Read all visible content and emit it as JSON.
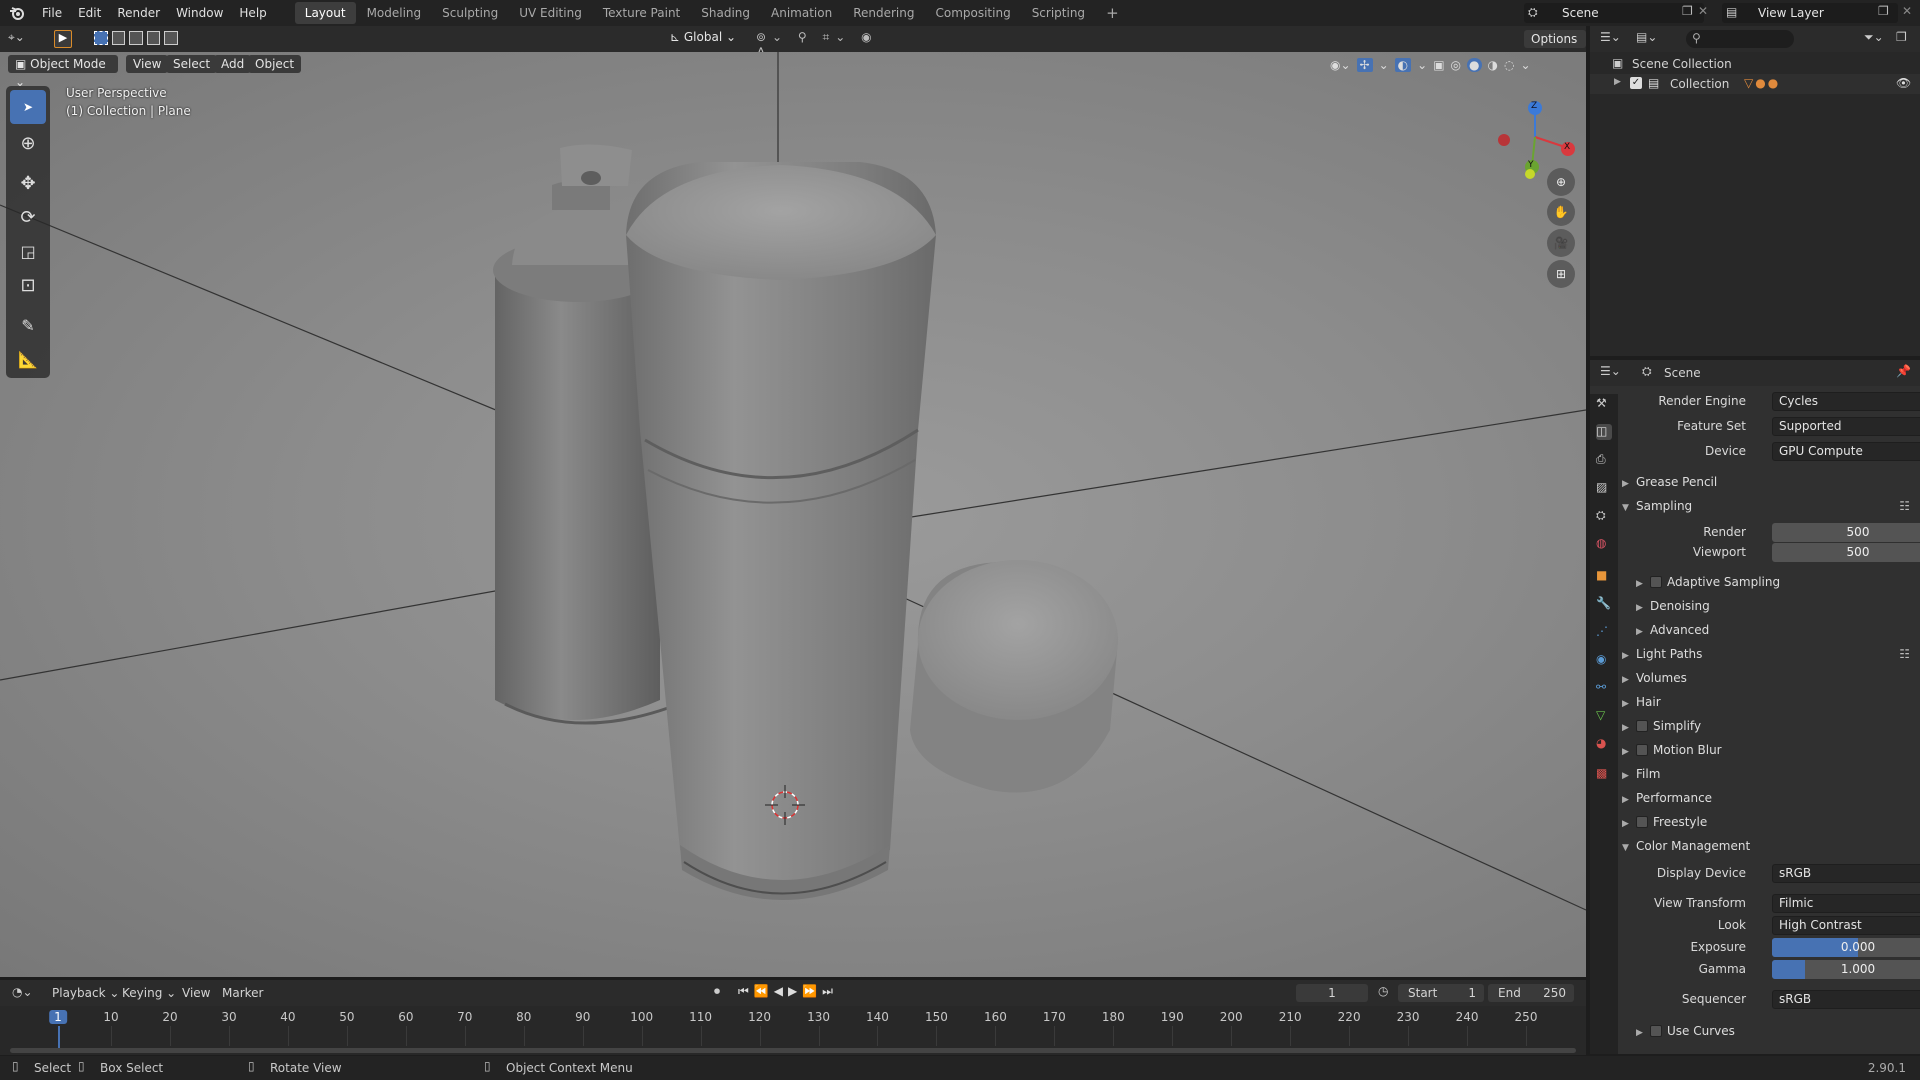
{
  "topbar": {
    "menus": [
      "File",
      "Edit",
      "Render",
      "Window",
      "Help"
    ],
    "workspaces": [
      "Layout",
      "Modeling",
      "Sculpting",
      "UV Editing",
      "Texture Paint",
      "Shading",
      "Animation",
      "Rendering",
      "Compositing",
      "Scripting"
    ],
    "active_workspace": "Layout",
    "add_tab": "+",
    "scene_name": "Scene",
    "view_layer": "View Layer"
  },
  "viewport_header": {
    "mode": "Object Mode",
    "menus": [
      "View",
      "Select",
      "Add",
      "Object"
    ],
    "orientation": "Global",
    "options": "Options"
  },
  "viewport": {
    "view_name": "User Perspective",
    "collection_info": "(1) Collection | Plane",
    "gizmo_axes": {
      "x": "X",
      "y": "Y",
      "z": "Z"
    }
  },
  "outliner": {
    "search_placeholder": "",
    "scene_collection": "Scene Collection",
    "collection": "Collection"
  },
  "properties": {
    "context": "Scene",
    "render_engine_label": "Render Engine",
    "render_engine": "Cycles",
    "feature_set_label": "Feature Set",
    "feature_set": "Supported",
    "device_label": "Device",
    "device": "GPU Compute",
    "panels": {
      "grease_pencil": "Grease Pencil",
      "sampling": "Sampling",
      "render_label": "Render",
      "render_samples": "500",
      "viewport_label": "Viewport",
      "viewport_samples": "500",
      "adaptive_sampling": "Adaptive Sampling",
      "denoising": "Denoising",
      "advanced": "Advanced",
      "light_paths": "Light Paths",
      "volumes": "Volumes",
      "hair": "Hair",
      "simplify": "Simplify",
      "motion_blur": "Motion Blur",
      "film": "Film",
      "performance": "Performance",
      "freestyle": "Freestyle",
      "color_management": "Color Management"
    },
    "color_management": {
      "display_device_label": "Display Device",
      "display_device": "sRGB",
      "view_transform_label": "View Transform",
      "view_transform": "Filmic",
      "look_label": "Look",
      "look": "High Contrast",
      "exposure_label": "Exposure",
      "exposure": "0.000",
      "exposure_fill": 0.5,
      "gamma_label": "Gamma",
      "gamma": "1.000",
      "gamma_fill": 0.19,
      "sequencer_label": "Sequencer",
      "sequencer": "sRGB",
      "use_curves": "Use Curves"
    }
  },
  "timeline": {
    "menus": [
      "Playback",
      "Keying",
      "View",
      "Marker"
    ],
    "current_frame": "1",
    "start_label": "Start",
    "start": "1",
    "end_label": "End",
    "end": "250",
    "ticks": [
      "1",
      "10",
      "20",
      "30",
      "40",
      "50",
      "60",
      "70",
      "80",
      "90",
      "100",
      "110",
      "120",
      "130",
      "140",
      "150",
      "160",
      "170",
      "180",
      "190",
      "200",
      "210",
      "220",
      "230",
      "240",
      "250"
    ]
  },
  "statusbar": {
    "select": "Select",
    "box_select": "Box Select",
    "rotate_view": "Rotate View",
    "context_menu": "Object Context Menu",
    "version": "2.90.1"
  },
  "colors": {
    "accent": "#4772b3",
    "active_tab": "#3d3d3d",
    "viewport_bg": "#8c8c8c"
  }
}
